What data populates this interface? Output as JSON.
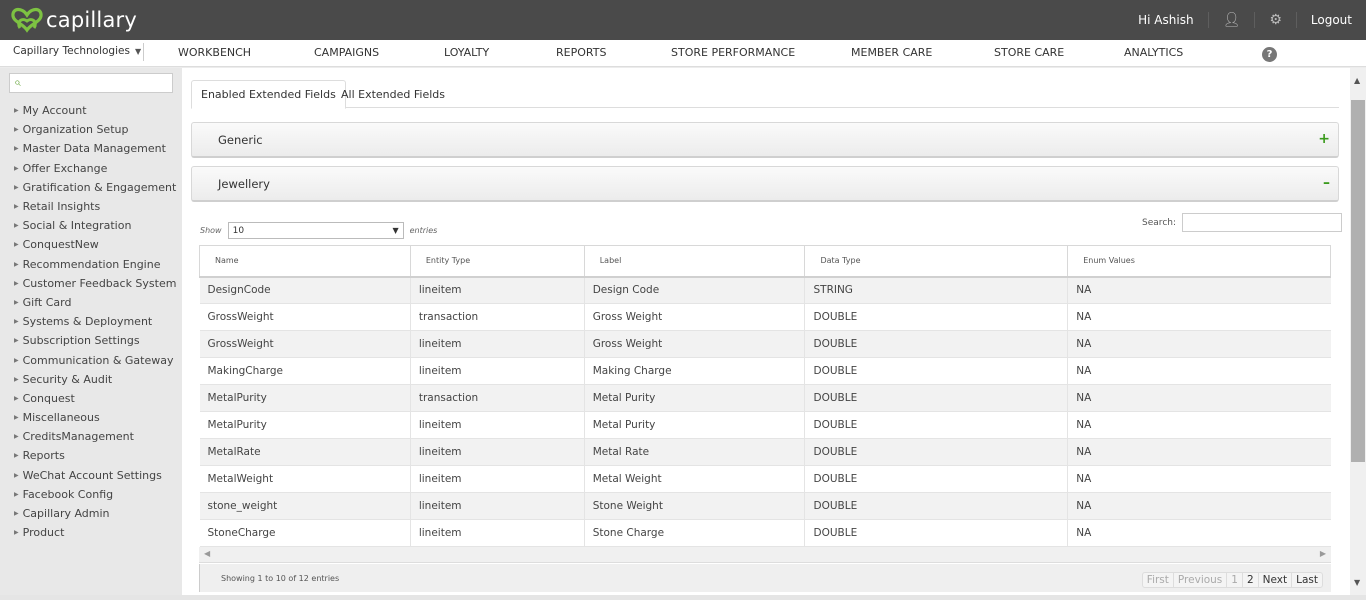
{
  "brand": {
    "name": "capillary",
    "accent": "#7dc242"
  },
  "topbar": {
    "greeting": "Hi Ashish",
    "user_icon": "user-settings-icon",
    "settings_icon": "gear-icon",
    "logout": "Logout"
  },
  "navbar": {
    "org": "Capillary Technologies",
    "items": [
      "WORKBENCH",
      "CAMPAIGNS",
      "LOYALTY",
      "REPORTS",
      "STORE PERFORMANCE",
      "MEMBER CARE",
      "STORE CARE",
      "ANALYTICS"
    ],
    "help": "?"
  },
  "sidebar": {
    "search_placeholder": "",
    "items": [
      "My Account",
      "Organization Setup",
      "Master Data Management",
      "Offer Exchange",
      "Gratification & Engagement",
      "Retail Insights",
      "Social & Integration",
      "ConquestNew",
      "Recommendation Engine",
      "Customer Feedback System",
      "Gift Card",
      "Systems & Deployment",
      "Subscription Settings",
      "Communication & Gateway",
      "Security & Audit",
      "Conquest",
      "Miscellaneous",
      "CreditsManagement",
      "Reports",
      "WeChat Account Settings",
      "Facebook Config",
      "Capillary Admin",
      "Product"
    ]
  },
  "tabs": [
    {
      "label": "Enabled Extended Fields",
      "active": true
    },
    {
      "label": "All Extended Fields",
      "active": false
    }
  ],
  "panels": [
    {
      "title": "Generic",
      "toggle": "+"
    },
    {
      "title": "Jewellery",
      "toggle": "–"
    }
  ],
  "table_controls": {
    "show_label": "Show",
    "page_size": "10",
    "entries_label": "entries",
    "search_label": "Search:",
    "search_value": ""
  },
  "table": {
    "columns": [
      "Name",
      "Entity Type",
      "Label",
      "Data Type",
      "Enum Values"
    ],
    "rows": [
      [
        "DesignCode",
        "lineitem",
        "Design Code",
        "STRING",
        "NA"
      ],
      [
        "GrossWeight",
        "transaction",
        "Gross Weight",
        "DOUBLE",
        "NA"
      ],
      [
        "GrossWeight",
        "lineitem",
        "Gross Weight",
        "DOUBLE",
        "NA"
      ],
      [
        "MakingCharge",
        "lineitem",
        "Making Charge",
        "DOUBLE",
        "NA"
      ],
      [
        "MetalPurity",
        "transaction",
        "Metal Purity",
        "DOUBLE",
        "NA"
      ],
      [
        "MetalPurity",
        "lineitem",
        "Metal Purity",
        "DOUBLE",
        "NA"
      ],
      [
        "MetalRate",
        "lineitem",
        "Metal Rate",
        "DOUBLE",
        "NA"
      ],
      [
        "MetalWeight",
        "lineitem",
        "Metal Weight",
        "DOUBLE",
        "NA"
      ],
      [
        "stone_weight",
        "lineitem",
        "Stone Weight",
        "DOUBLE",
        "NA"
      ],
      [
        "StoneCharge",
        "lineitem",
        "Stone Charge",
        "DOUBLE",
        "NA"
      ]
    ]
  },
  "footer": {
    "info": "Showing 1 to 10 of 12 entries",
    "pager": [
      {
        "label": "First",
        "disabled": true
      },
      {
        "label": "Previous",
        "disabled": true
      },
      {
        "label": "1",
        "disabled": true
      },
      {
        "label": "2",
        "disabled": false
      },
      {
        "label": "Next",
        "disabled": false
      },
      {
        "label": "Last",
        "disabled": false
      }
    ]
  }
}
